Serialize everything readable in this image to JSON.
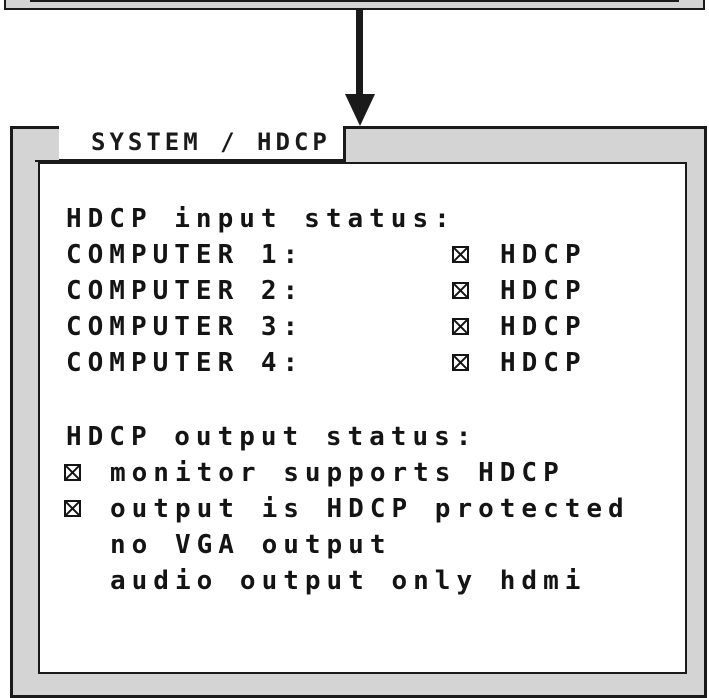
{
  "panel": {
    "title": "SYSTEM / HDCP"
  },
  "input_status": {
    "heading": "HDCP input status:",
    "rows": [
      {
        "label": "COMPUTER 1:",
        "status": "HDCP",
        "checked": true
      },
      {
        "label": "COMPUTER 2:",
        "status": "HDCP",
        "checked": true
      },
      {
        "label": "COMPUTER 3:",
        "status": "HDCP",
        "checked": true
      },
      {
        "label": "COMPUTER 4:",
        "status": "HDCP",
        "checked": true
      }
    ]
  },
  "output_status": {
    "heading": "HDCP output status:",
    "lines": [
      {
        "text": "monitor supports HDCP",
        "checked": true
      },
      {
        "text": "output is HDCP protected",
        "checked": true
      },
      {
        "text": "no VGA output",
        "checked": false
      },
      {
        "text": "audio output only hdmi",
        "checked": false
      }
    ]
  },
  "icons": {
    "arrow": "arrow-down-icon",
    "checkbox": "checked-box-icon"
  },
  "colors": {
    "frame": "#d4d4d4",
    "ink": "#141414",
    "background": "#ffffff"
  }
}
